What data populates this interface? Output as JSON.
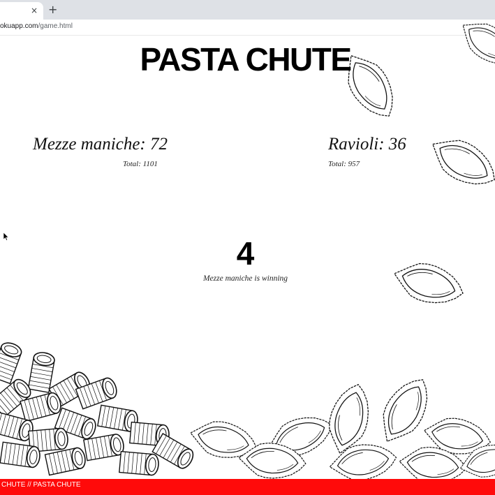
{
  "browser": {
    "tab_close": "×",
    "new_tab": "+",
    "url_host": "okuapp.com",
    "url_path": "/game.html"
  },
  "game": {
    "title": "PASTA CHUTE",
    "teams": [
      {
        "name": "Mezze maniche: 72",
        "total": "Total: 1101"
      },
      {
        "name": "Ravioli: 36",
        "total": "Total: 957"
      }
    ],
    "countdown": "4",
    "status": "Mezze maniche is winning",
    "ticker": "CHUTE // PASTA CHUTE"
  },
  "icons": {
    "falling": "ravioli-icon",
    "pile_left": "mezze-maniche-pasta-icon",
    "pile_right": "ravioli-icon",
    "cursor": "mouse-pointer-icon"
  }
}
